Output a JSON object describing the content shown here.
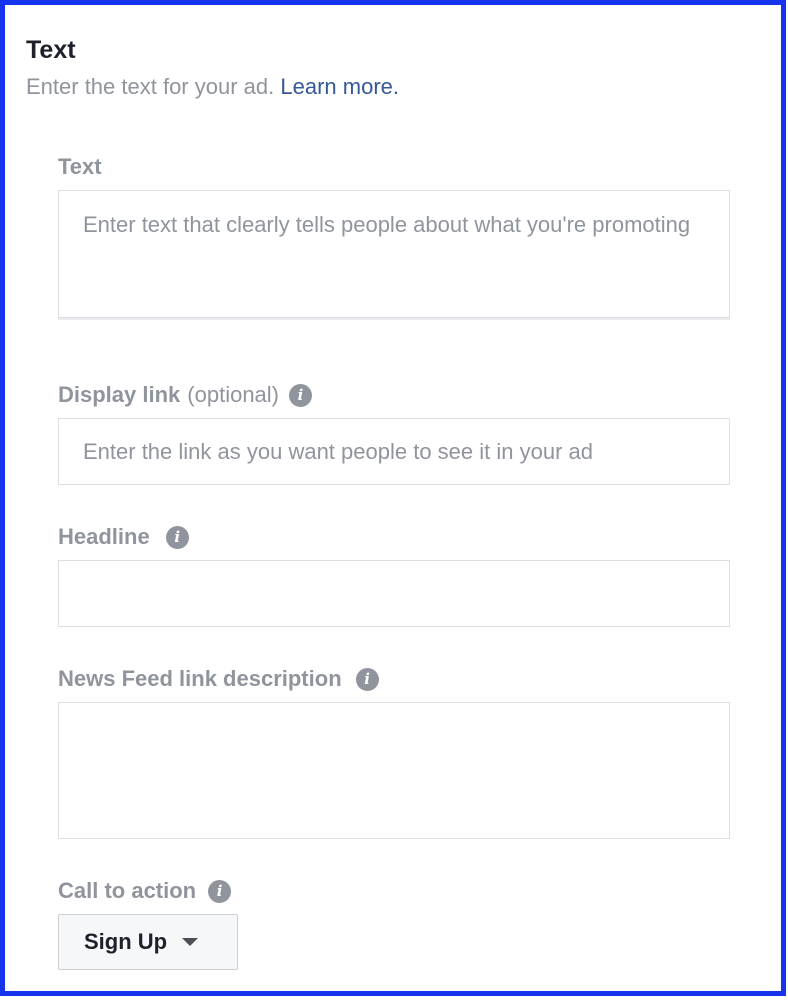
{
  "section": {
    "title": "Text",
    "subtitle": "Enter the text for your ad.",
    "learn_more": "Learn more."
  },
  "fields": {
    "text": {
      "label": "Text",
      "placeholder": "Enter text that clearly tells people about what you're promoting"
    },
    "display_link": {
      "label": "Display link",
      "optional": "(optional)",
      "placeholder": "Enter the link as you want people to see it in your ad"
    },
    "headline": {
      "label": "Headline",
      "value": ""
    },
    "news_feed_description": {
      "label": "News Feed link description",
      "value": ""
    },
    "call_to_action": {
      "label": "Call to action",
      "selected": "Sign Up"
    }
  },
  "icons": {
    "info": "info-icon",
    "dropdown": "caret-down-icon"
  },
  "colors": {
    "frame_border": "#1633ee",
    "link": "#365899",
    "label": "#90949c"
  }
}
